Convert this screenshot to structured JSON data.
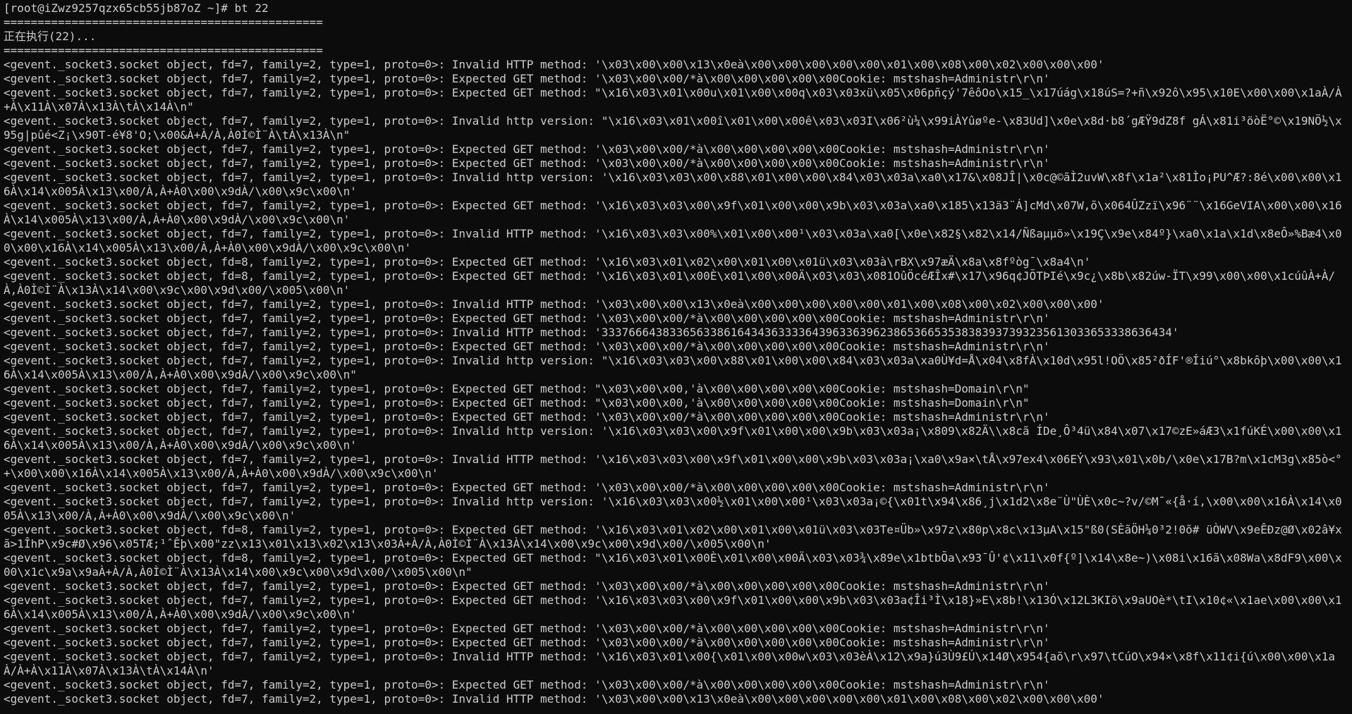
{
  "terminal": {
    "lines": [
      "[root@iZwz9257qzx65cb55jb87oZ ~]# bt 22",
      "===============================================",
      "正在执行(22)...",
      "===============================================",
      "<gevent._socket3.socket object, fd=7, family=2, type=1, proto=0>: Invalid HTTP method: '\\x03\\x00\\x00\\x13\\x0eà\\x00\\x00\\x00\\x00\\x00\\x01\\x00\\x08\\x00\\x02\\x00\\x00\\x00'",
      "<gevent._socket3.socket object, fd=7, family=2, type=1, proto=0>: Expected GET method: '\\x03\\x00\\x00/*à\\x00\\x00\\x00\\x00\\x00Cookie: mstshash=Administr\\r\\n'",
      "<gevent._socket3.socket object, fd=7, family=2, type=1, proto=0>: Expected GET method: \"\\x16\\x03\\x01\\x00u\\x01\\x00\\x00q\\x03\\x03xü\\x05\\x06pñçý'7êôOo\\x15_\\x17úág\\x18úS=?+ñ\\x92ô\\x95\\x10E\\x00\\x00\\x1aÀ/À+À\\x11À\\x07À\\x13À\\tÀ\\x14À\\n\"",
      "<gevent._socket3.socket object, fd=7, family=2, type=1, proto=0>: Invalid http version: \"\\x16\\x03\\x01\\x00î\\x01\\x00\\x00ê\\x03\\x03I\\x06²ù¼\\x99iÀYûøºe-\\x83Ud]\\x0e\\x8d·b8´gÆŸ9dZ8f gÁ\\x81i³öòË°©\\x19NÖ½\\x95g|pûé<Z¡\\x90T-é¥8'O;\\x00&À+À/À,À0Ì©Ì¨À\\tÀ\\x13À\\n\"",
      "<gevent._socket3.socket object, fd=7, family=2, type=1, proto=0>: Expected GET method: '\\x03\\x00\\x00/*à\\x00\\x00\\x00\\x00\\x00Cookie: mstshash=Administr\\r\\n'",
      "<gevent._socket3.socket object, fd=7, family=2, type=1, proto=0>: Expected GET method: '\\x03\\x00\\x00/*à\\x00\\x00\\x00\\x00\\x00Cookie: mstshash=Administr\\r\\n'",
      "<gevent._socket3.socket object, fd=7, family=2, type=1, proto=0>: Invalid http version: '\\x16\\x03\\x03\\x00\\x88\\x01\\x00\\x00\\x84\\x03\\x03a\\xa0\\x17&\\x08JÎ|\\x0c@©ãÌ2uvW\\x8f\\x1a²\\x81Ìo¡PU^Æ?:8é\\x00\\x00\\x16À\\x14\\x005À\\x13\\x00/À,À+À0\\x00\\x9dÀ/\\x00\\x9c\\x00\\n'",
      "<gevent._socket3.socket object, fd=7, family=2, type=1, proto=0>: Expected GET method: '\\x16\\x03\\x03\\x00\\x9f\\x01\\x00\\x00\\x9b\\x03\\x03a\\xa0\\x185\\x13ä3¨Á]cMd\\x07W,õ\\x064ÛZzï\\x96¨¨\\x16GeVIA\\x00\\x00\\x16À\\x14\\x005À\\x13\\x00/À,À+À0\\x00\\x9dÀ/\\x00\\x9c\\x00\\n'",
      "<gevent._socket3.socket object, fd=7, family=2, type=1, proto=0>: Invalid HTTP method: '\\x16\\x03\\x03\\x00%\\x01\\x00\\x00¹\\x03\\x03a\\xa0[\\x0e\\x82§\\x82\\x14/Ñßaµµö»\\x19Ç\\x9e\\x84º}\\xa0\\x1a\\x1d\\x8eÔ»%Bæ4\\x00\\x00\\x16À\\x14\\x005À\\x13\\x00/À,À+À0\\x00\\x9dÀ/\\x00\\x9c\\x00\\n'",
      "<gevent._socket3.socket object, fd=8, family=2, type=1, proto=0>: Expected GET method: '\\x16\\x03\\x01\\x02\\x00\\x01\\x00\\x01ü\\x03\\x03à\\rBX\\x97æÄ\\x8a\\x8fºòg¯\\x8a4\\n'",
      "<gevent._socket3.socket object, fd=8, family=2, type=1, proto=0>: Expected GET method: '\\x16\\x03\\x01\\x00È\\x01\\x00\\x00Ä\\x03\\x03\\x081OûÖcéÆÎx#\\x17\\x96q¢JÕTÞIé\\x9c¿\\x8b\\x82úw-ÏT\\x99\\x00\\x00\\x1cúûÀ+À/À,À0Ì©Ì¨À\\x13À\\x14\\x00\\x9c\\x00\\x9d\\x00/\\x005\\x00\\n'",
      "<gevent._socket3.socket object, fd=7, family=2, type=1, proto=0>: Invalid HTTP method: '\\x03\\x00\\x00\\x13\\x0eà\\x00\\x00\\x00\\x00\\x00\\x01\\x00\\x08\\x00\\x02\\x00\\x00\\x00'",
      "<gevent._socket3.socket object, fd=7, family=2, type=1, proto=0>: Expected GET method: '\\x03\\x00\\x00/*à\\x00\\x00\\x00\\x00\\x00Cookie: mstshash=Administr\\r\\n'",
      "<gevent._socket3.socket object, fd=7, family=2, type=1, proto=0>: Invalid HTTP method: '333766643833656338616434363333643963363962386536653538383937393235613033653338636434'",
      "<gevent._socket3.socket object, fd=7, family=2, type=1, proto=0>: Expected GET method: '\\x03\\x00\\x00/*à\\x00\\x00\\x00\\x00\\x00Cookie: mstshash=Administr\\r\\n'",
      "<gevent._socket3.socket object, fd=7, family=2, type=1, proto=0>: Invalid http version: \"\\x16\\x03\\x03\\x00\\x88\\x01\\x00\\x00\\x84\\x03\\x03a\\xa0Ù¥d=Å\\x04\\x8fÀ\\x10d\\x95l!OÖ\\x85²ðÍF'®Íiú°\\x8bkôþ\\x00\\x00\\x16À\\x14\\x005À\\x13\\x00/À,À+À0\\x00\\x9dÀ/\\x00\\x9c\\x00\\n\"",
      "<gevent._socket3.socket object, fd=7, family=2, type=1, proto=0>: Expected GET method: \"\\x03\\x00\\x00,'à\\x00\\x00\\x00\\x00\\x00Cookie: mstshash=Domain\\r\\n\"",
      "<gevent._socket3.socket object, fd=7, family=2, type=1, proto=0>: Expected GET method: \"\\x03\\x00\\x00,'à\\x00\\x00\\x00\\x00\\x00Cookie: mstshash=Domain\\r\\n\"",
      "<gevent._socket3.socket object, fd=7, family=2, type=1, proto=0>: Expected GET method: '\\x03\\x00\\x00/*à\\x00\\x00\\x00\\x00\\x00Cookie: mstshash=Administr\\r\\n'",
      "<gevent._socket3.socket object, fd=7, family=2, type=1, proto=0>: Invalid http version: '\\x16\\x03\\x03\\x00\\x9f\\x01\\x00\\x00\\x9b\\x03\\x03a¡\\x809\\x82Ä\\\\x8cã ÍDe¸Ô³4ü\\x84\\x07\\x17©zE»áÆ3\\x1fúKÉ\\x00\\x00\\x16À\\x14\\x005À\\x13\\x00/À,À+À0\\x00\\x9dÀ/\\x00\\x9c\\x00\\n'",
      "<gevent._socket3.socket object, fd=7, family=2, type=1, proto=0>: Invalid HTTP method: '\\x16\\x03\\x03\\x00\\x9f\\x01\\x00\\x00\\x9b\\x03\\x03a¡\\xa0\\x9a×\\tÅ\\x97ex4\\x06EÝ\\x93\\x01\\x0b/\\x0e\\x17B?m\\x1cM3g\\x85ò<°+\\x00\\x00\\x16À\\x14\\x005À\\x13\\x00/À,À+À0\\x00\\x9dÀ/\\x00\\x9c\\x00\\n'",
      "<gevent._socket3.socket object, fd=7, family=2, type=1, proto=0>: Expected GET method: '\\x03\\x00\\x00/*à\\x00\\x00\\x00\\x00\\x00Cookie: mstshash=Administr\\r\\n'",
      "<gevent._socket3.socket object, fd=7, family=2, type=1, proto=0>: Invalid http version: '\\x16\\x03\\x03\\x00½\\x01\\x00\\x00¹\\x03\\x03a¡©{\\x01t\\x94\\x86¸j\\x1d2\\x8e¨Ù\"ÙÈ\\x0c~?v/©M¯«{å·í,\\x00\\x00\\x16À\\x14\\x005À\\x13\\x00/À,À+À0\\x00\\x9dÀ/\\x00\\x9c\\x00\\n'",
      "<gevent._socket3.socket object, fd=8, family=2, type=1, proto=0>: Expected GET method: '\\x16\\x03\\x01\\x02\\x00\\x01\\x00\\x01ü\\x03\\x03Te¤Üb»\\x97z\\x80p\\x8c\\x13µA\\x15\"ß0(SÈãÖH¼0³2!0õ# üÒWV\\x9eÊÐz@Ø\\x02â¥xã>1ÎhP\\x9c#Ø\\x96\\x05TÆ;¹ˆÊþ\\x00\"zz\\x13\\x01\\x13\\x02\\x13\\x03À+À/À,À0Ì©Ì¨À\\x13À\\x14\\x00\\x9c\\x00\\x9d\\x00/\\x005\\x00\\n'",
      "<gevent._socket3.socket object, fd=8, family=2, type=1, proto=0>: Expected GET method: \"\\x16\\x03\\x01\\x00È\\x01\\x00\\x00Ä\\x03\\x03¾\\x89e\\x1btbÕa\\x93¯Û'¢\\x11\\x0f{º]\\x14\\x8e~)\\x08i\\x16ã\\x08Wa\\x8dF9\\x00\\x00\\x1c\\x9a\\x9aÀ+À/À,À0Ì©Ì¨À\\x13À\\x14\\x00\\x9c\\x00\\x9d\\x00/\\x005\\x00\\n\"",
      "<gevent._socket3.socket object, fd=7, family=2, type=1, proto=0>: Expected GET method: '\\x03\\x00\\x00/*à\\x00\\x00\\x00\\x00\\x00Cookie: mstshash=Administr\\r\\n'",
      "<gevent._socket3.socket object, fd=7, family=2, type=1, proto=0>: Expected GET method: '\\x16\\x03\\x03\\x00\\x9f\\x01\\x00\\x00\\x9b\\x03\\x03a¢Îi³Ì\\x18}»E\\x8b!\\x13Ó\\x12L3KIö\\x9aUOè*\\tI\\x10¢«\\x1ae\\x00\\x00\\x16À\\x14\\x005À\\x13\\x00/À,À+À0\\x00\\x9dÀ/\\x00\\x9c\\x00\\n'",
      "<gevent._socket3.socket object, fd=7, family=2, type=1, proto=0>: Expected GET method: '\\x03\\x00\\x00/*à\\x00\\x00\\x00\\x00\\x00Cookie: mstshash=Administr\\r\\n'",
      "<gevent._socket3.socket object, fd=7, family=2, type=1, proto=0>: Expected GET method: '\\x03\\x00\\x00/*à\\x00\\x00\\x00\\x00\\x00Cookie: mstshash=Administr\\r\\n'",
      "<gevent._socket3.socket object, fd=7, family=2, type=1, proto=0>: Invalid HTTP method: '\\x16\\x03\\x01\\x00{\\x01\\x00\\x00w\\x03\\x03èÀ\\x12\\x9a}ú3Ù9£Ú\\x14Ø\\x954{aõ\\r\\x97\\tCúO\\x94×\\x8f\\x11¢i{ú\\x00\\x00\\x1aÀ/À+À\\x11À\\x07À\\x13À\\tÀ\\x14À\\n'",
      "<gevent._socket3.socket object, fd=7, family=2, type=1, proto=0>: Expected GET method: '\\x03\\x00\\x00/*à\\x00\\x00\\x00\\x00\\x00Cookie: mstshash=Administr\\r\\n'",
      "<gevent._socket3.socket object, fd=7, family=2, type=1, proto=0>: Invalid HTTP method: '\\x03\\x00\\x00\\x13\\x0eà\\x00\\x00\\x00\\x00\\x00\\x01\\x00\\x08\\x00\\x02\\x00\\x00\\x00'"
    ]
  },
  "colors": {
    "background": "#0c0c0c",
    "text": "#cccccc"
  }
}
